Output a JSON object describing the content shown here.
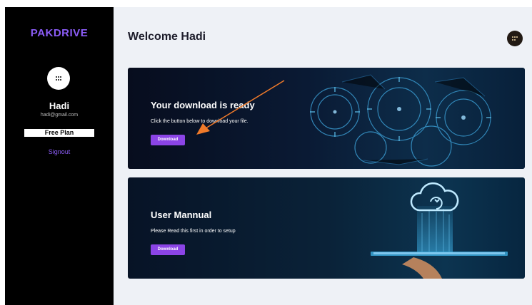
{
  "sidebar": {
    "logo": "PAKDRIVE",
    "user_name": "Hadi",
    "user_email": "hadi@gmail.com",
    "plan": "Free Plan",
    "signout": "Signout",
    "avatar_icon": "grid-dots-icon"
  },
  "header": {
    "welcome": "Welcome Hadi",
    "menu_icon": "grid-dots-icon"
  },
  "cards": [
    {
      "title": "Your download is ready",
      "text": "Click the button below to download your file.",
      "button": "Download"
    },
    {
      "title": "User Mannual",
      "text": "Please Read this first in order to setup",
      "button": "Download"
    }
  ],
  "colors": {
    "accent": "#8b44e6",
    "brand": "#8b5cf6",
    "arrow": "#f07a2a",
    "sidebar_bg": "#000000",
    "main_bg": "#eef1f6"
  }
}
